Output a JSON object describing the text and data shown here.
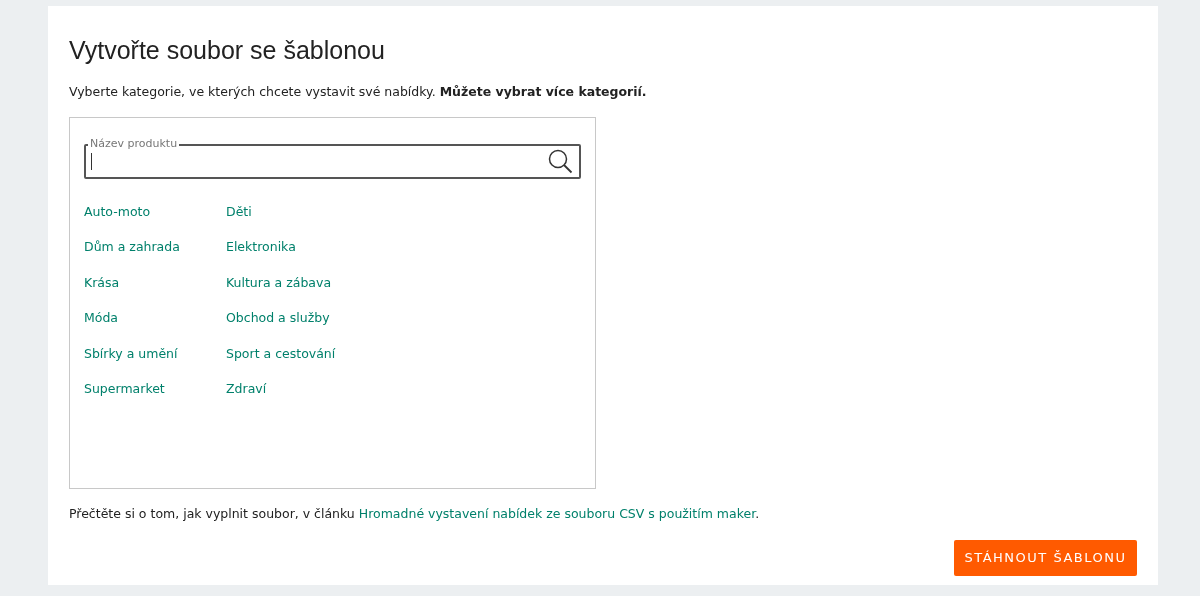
{
  "title": "Vytvořte soubor se šablonou",
  "intro": "Vyberte kategorie, ve kterých chcete vystavit své nabídky. **Můžete vybrat více kategorií.**",
  "search": {
    "label": "Název produktu"
  },
  "categories": [
    "Auto-moto",
    "Děti",
    "Dům a zahrada",
    "Elektronika",
    "Krása",
    "Kultura a zábava",
    "Móda",
    "Obchod a služby",
    "Sbírky a umění",
    "Sport a cestování",
    "Supermarket",
    "Zdraví"
  ],
  "help": {
    "text": "Přečtěte si o tom, jak vyplnit soubor, v článku ",
    "link": "Hromadné vystavení nabídek ze souboru CSV s použitím maker",
    "suffix": "."
  },
  "button": "STÁHNOUT ŠABLONU"
}
